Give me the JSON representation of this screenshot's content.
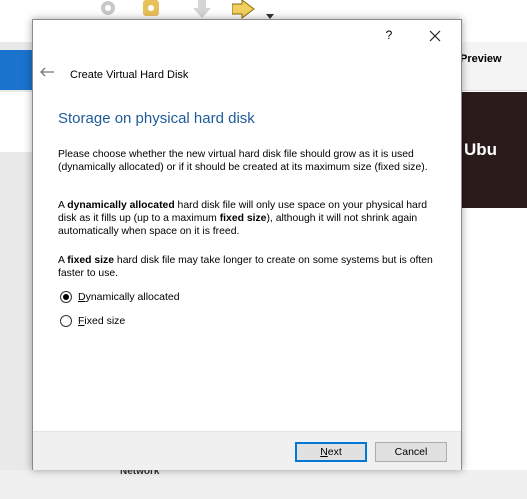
{
  "background": {
    "preview_label": "Preview",
    "preview_text": "Ubu",
    "network_label": "Network"
  },
  "dialog": {
    "help_label": "?",
    "title": "Create Virtual Hard Disk",
    "page_title": "Storage on physical hard disk",
    "intro": "Please choose whether the new virtual hard disk file should grow as it is used (dynamically allocated) or if it should be created at its maximum size (fixed size).",
    "dynamic_para": {
      "p1": "A ",
      "b1": "dynamically allocated",
      "p2": " hard disk file will only use space on your physical hard disk as it fills up (up to a maximum ",
      "b2": "fixed size",
      "p3": "), although it will not shrink again automatically when space on it is freed."
    },
    "fixed_para": {
      "p1": "A ",
      "b1": "fixed size",
      "p2": " hard disk file may take longer to create on some systems but is often faster to use."
    },
    "options": [
      {
        "mnemonic": "D",
        "rest": "ynamically allocated",
        "selected": true
      },
      {
        "mnemonic": "F",
        "rest": "ixed size",
        "selected": false
      }
    ],
    "buttons": {
      "next_mnemonic": "N",
      "next_rest": "ext",
      "cancel": "Cancel"
    }
  },
  "colors": {
    "title_blue": "#1e5b9b",
    "default_button_border": "#0078d7",
    "selection_blue": "#1a73cc"
  }
}
